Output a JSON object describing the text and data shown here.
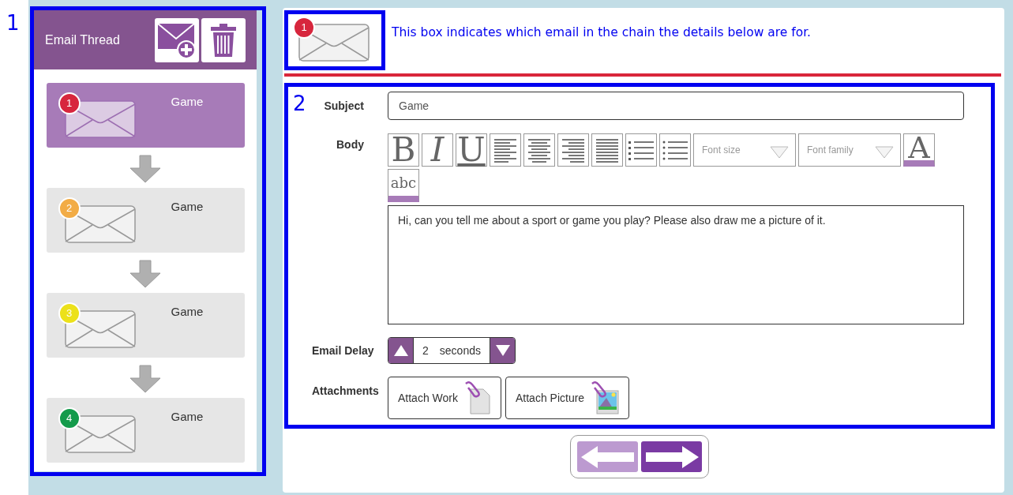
{
  "annotations": [
    {
      "number": "1"
    },
    {
      "number": "2"
    }
  ],
  "callout": {
    "text": "This box indicates which email in the chain the details below are for."
  },
  "thread": {
    "title": "Email Thread",
    "emails": [
      {
        "number": "1",
        "color": "#d7263d",
        "subject": "Game",
        "selected": true
      },
      {
        "number": "2",
        "color": "#f2ac46",
        "subject": "Game",
        "selected": false
      },
      {
        "number": "3",
        "color": "#ece11a",
        "subject": "Game",
        "selected": false
      },
      {
        "number": "4",
        "color": "#149b4b",
        "subject": "Game",
        "selected": false
      }
    ]
  },
  "current_email": {
    "number": "1",
    "color": "#d7263d"
  },
  "form": {
    "subject": {
      "label": "Subject",
      "value": "Game"
    },
    "body": {
      "label": "Body",
      "toolbar": [
        {
          "kind": "bold",
          "text": "B"
        },
        {
          "kind": "italic",
          "text": "I"
        },
        {
          "kind": "underline",
          "text": "U"
        },
        {
          "kind": "align-left"
        },
        {
          "kind": "align-center"
        },
        {
          "kind": "align-right"
        },
        {
          "kind": "align-justify"
        },
        {
          "kind": "ordered-list"
        },
        {
          "kind": "bullet-list"
        },
        {
          "kind": "select",
          "placeholder": "Font size"
        },
        {
          "kind": "select",
          "placeholder": "Font family"
        },
        {
          "kind": "color",
          "text": "A"
        },
        {
          "kind": "spellcheck",
          "text": "abc"
        }
      ],
      "text": "Hi, can you tell me about a sport or game you play? Please also draw me a picture of it."
    },
    "delay": {
      "label": "Email Delay",
      "value": "2",
      "unit": "seconds"
    },
    "attachments": {
      "label": "Attachments",
      "buttons": [
        {
          "label": "Attach Work",
          "kind": "work"
        },
        {
          "label": "Attach Picture",
          "kind": "picture"
        }
      ]
    }
  },
  "navigation": {
    "back": {
      "disabled": true
    },
    "forward": {
      "disabled": false
    }
  }
}
